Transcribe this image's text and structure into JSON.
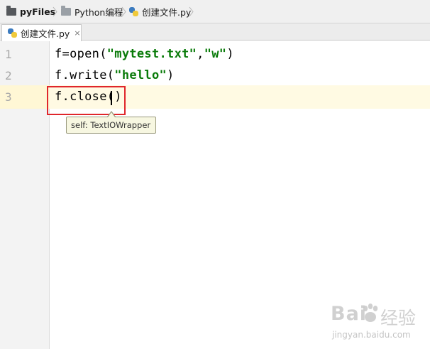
{
  "breadcrumb": {
    "project": "pyFiles",
    "folder": "Python编程",
    "file": "创建文件.py"
  },
  "tabs": [
    {
      "label": "创建文件.py",
      "close": "×",
      "active": true
    }
  ],
  "editor": {
    "line_numbers": [
      "1",
      "2",
      "3"
    ],
    "lines": [
      {
        "parts": [
          "f=open(",
          "\"mytest.txt\"",
          ",",
          "\"w\"",
          ")"
        ]
      },
      {
        "parts": [
          "f.write(",
          "\"hello\"",
          ")"
        ]
      },
      {
        "parts": [
          "f.close",
          "()"
        ]
      }
    ],
    "current_line": 3
  },
  "tooltip": {
    "text": "self: TextIOWrapper"
  },
  "watermark": {
    "brand_left": "Bai",
    "brand_right": "经验",
    "url": "jingyan.baidu.com"
  },
  "colors": {
    "string": "#0a7b0a",
    "annotation_box": "#e0262b",
    "current_line": "#fffae3",
    "tooltip_bg": "#f7f7e1"
  }
}
